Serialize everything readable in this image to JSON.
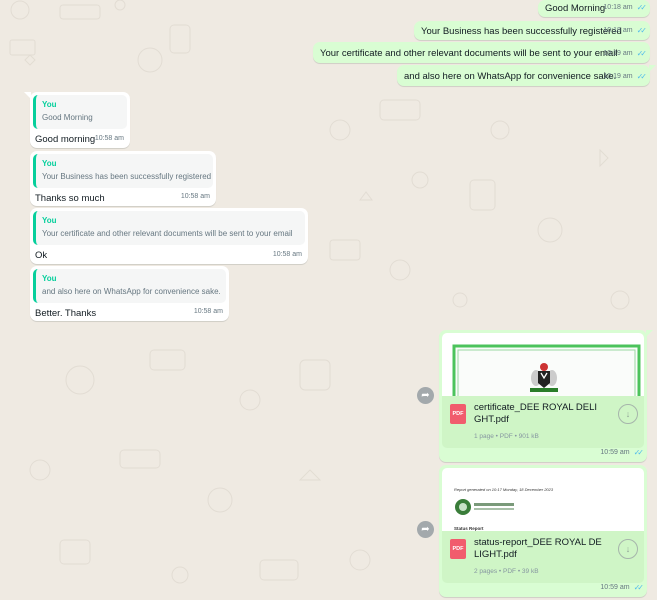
{
  "outgoing_messages": [
    {
      "text": "Good Morning",
      "time": "10:18 am",
      "status": "read-double-tick-icon"
    },
    {
      "text": "Your Business has been successfully registered",
      "time": "10:18 am",
      "status": "read-double-tick-icon"
    },
    {
      "text": "Your certificate and other relevant documents will be sent to your email",
      "time": "10:19 am",
      "status": "read-double-tick-icon"
    },
    {
      "text": "and also here on WhatsApp for convenience sake.",
      "time": "10:19 am",
      "status": "read-double-tick-icon"
    }
  ],
  "incoming_replies": [
    {
      "quote_author": "You",
      "quote_text": "Good Morning",
      "text": "Good morning",
      "time": "10:58 am"
    },
    {
      "quote_author": "You",
      "quote_text": "Your Business has been successfully registered",
      "text": "Thanks so much",
      "time": "10:58 am"
    },
    {
      "quote_author": "You",
      "quote_text": "Your certificate and other relevant documents will be sent to your email",
      "text": "Ok",
      "time": "10:58 am"
    },
    {
      "quote_author": "You",
      "quote_text": "and also here on WhatsApp for convenience sake.",
      "text": "Better. Thanks",
      "time": "10:58 am"
    }
  ],
  "documents": [
    {
      "file_name": "certificate_DEE ROYAL DELIGHT.pdf",
      "details": "1 page • PDF • 901 kB",
      "file_type_label": "PDF",
      "time": "10:59 am",
      "status": "read-double-tick-icon"
    },
    {
      "file_name": "status-report_DEE ROYAL DELIGHT.pdf",
      "details": "2 pages • PDF • 39 kB",
      "file_type_label": "PDF",
      "time": "10:59 am",
      "status": "read-double-tick-icon",
      "preview_line": "Report generated on 10:17 Monday, 18 December 2023",
      "preview_heading": "Status Report"
    }
  ],
  "icons": {
    "ticks": "✓✓",
    "forward": "➦",
    "download": "↓"
  },
  "colors": {
    "chat_background": "#efeae2",
    "outgoing_bubble": "#d9fdd3",
    "incoming_bubble": "#ffffff",
    "quote_accent": "#06cf9c",
    "read_tick": "#53bdeb",
    "pdf_red": "#f15c6d"
  }
}
